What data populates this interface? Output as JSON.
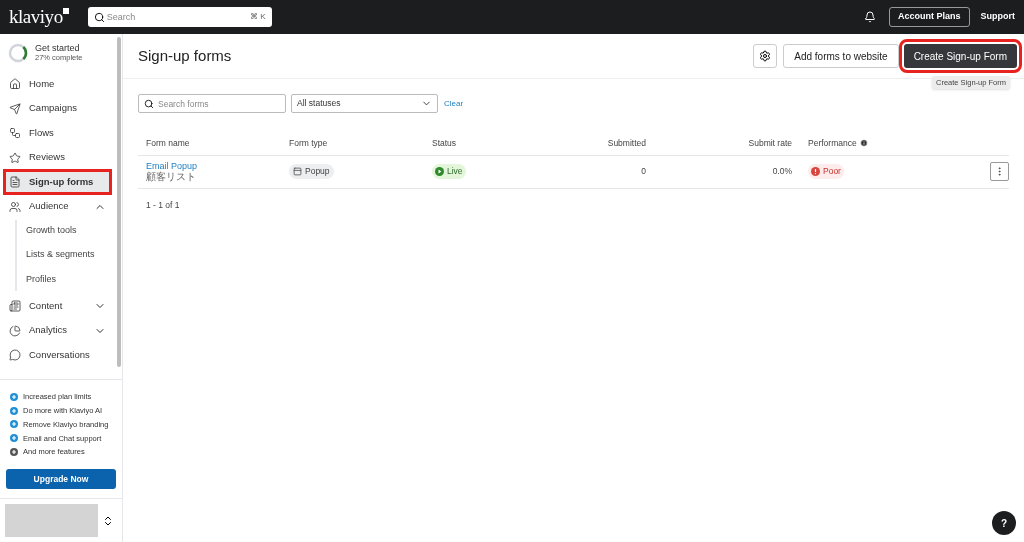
{
  "topbar": {
    "logo": "klaviyo",
    "search": {
      "placeholder": "Search",
      "shortcut": "⌘ K"
    },
    "account_plans": "Account Plans",
    "support": "Support"
  },
  "sidebar": {
    "get_started": {
      "title": "Get started",
      "subtitle": "27% complete",
      "level": 0.27
    },
    "items": [
      {
        "label": "Home",
        "selected": false,
        "highlighted": false
      },
      {
        "label": "Campaigns",
        "selected": false,
        "highlighted": false
      },
      {
        "label": "Flows",
        "selected": false,
        "highlighted": false
      },
      {
        "label": "Reviews",
        "selected": false,
        "highlighted": false
      },
      {
        "label": "Sign-up forms",
        "selected": true,
        "highlighted": true
      },
      {
        "label": "Audience",
        "selected": false,
        "highlighted": false,
        "expanded": true,
        "children": [
          {
            "label": "Growth tools",
            "selected": false
          },
          {
            "label": "Lists & segments",
            "selected": false
          },
          {
            "label": "Profiles",
            "selected": false
          }
        ]
      },
      {
        "label": "Content",
        "selected": false,
        "highlighted": false,
        "expanded": false
      },
      {
        "label": "Analytics",
        "selected": false,
        "highlighted": false,
        "expanded": false
      },
      {
        "label": "Conversations",
        "selected": false,
        "highlighted": false
      }
    ],
    "features": [
      {
        "label": "Increased plan limits",
        "color": "#1f8fd6"
      },
      {
        "label": "Do more with Klaviyo AI",
        "color": "#1f8fd6"
      },
      {
        "label": "Remove Klaviyo branding",
        "color": "#1f8fd6"
      },
      {
        "label": "Email and Chat support",
        "color": "#1f8fd6"
      },
      {
        "label": "And more features",
        "color": "#555555"
      }
    ],
    "upgrade": "Upgrade Now"
  },
  "page": {
    "title": "Sign-up forms",
    "add_button": "Add forms to website",
    "create_button": {
      "label": "Create Sign-up Form",
      "highlighted": true
    },
    "tooltip": "Create Sign-up Form"
  },
  "filters": {
    "search": {
      "placeholder": "Search forms"
    },
    "status": "All statuses",
    "clear": "Clear"
  },
  "table": {
    "columns": [
      "Form name",
      "Form type",
      "Status",
      "Submitted",
      "Submit rate",
      "Performance"
    ],
    "rows": [
      {
        "name": "Email Popup",
        "list": "顧客リスト",
        "type": "Popup",
        "status": "Live",
        "submitted": "0",
        "rate": "0.0%",
        "performance": "Poor"
      }
    ]
  },
  "pagination": "1 - 1 of 1",
  "help": "?"
}
